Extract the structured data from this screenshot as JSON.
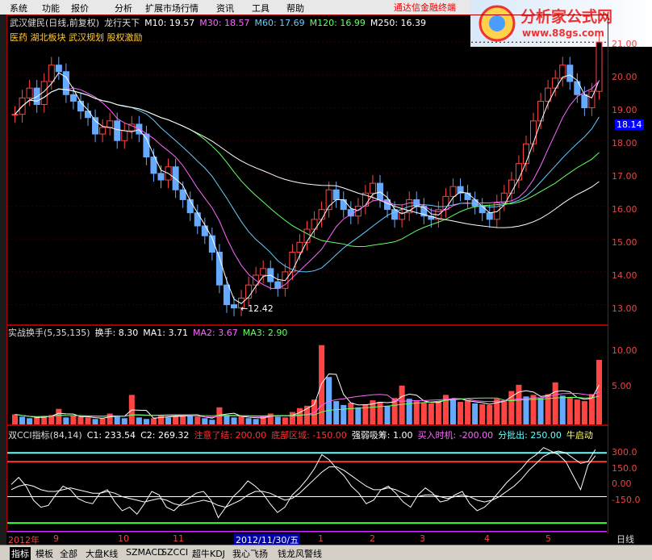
{
  "menu": [
    "系统",
    "功能",
    "报价",
    "分析",
    "扩展市场行情",
    "资讯",
    "工具",
    "帮助"
  ],
  "alert_text": "通达信金融终端",
  "brand": {
    "title": "分析家公式网",
    "url": "www.88gs.com"
  },
  "main_header": {
    "stock": "武汉健民(日线,前复权)",
    "indicator": "龙行天下",
    "items": [
      {
        "label": "M10: 19.57",
        "color": "#ffffff"
      },
      {
        "label": "M30: 18.57",
        "color": "#ff66ff"
      },
      {
        "label": "M60: 17.69",
        "color": "#66ccff"
      },
      {
        "label": "M120: 16.99",
        "color": "#66ff66"
      },
      {
        "label": "M250: 16.39",
        "color": "#ffffff"
      }
    ],
    "concepts": "医药 湖北板块 武汉规划 股权激励"
  },
  "vol_header": {
    "name": "实战换手(5,35,135)",
    "items": [
      {
        "label": "换手: 8.30",
        "color": "#ffffff"
      },
      {
        "label": "MA1: 3.71",
        "color": "#ffffff"
      },
      {
        "label": "MA2: 3.67",
        "color": "#ff66ff"
      },
      {
        "label": "MA3: 2.90",
        "color": "#66ff66"
      }
    ]
  },
  "cci_header": {
    "name": "双CCI指标(84,14)",
    "items": [
      {
        "label": "C1: 233.54",
        "color": "#ffffff"
      },
      {
        "label": "C2: 269.32",
        "color": "#ffffff"
      },
      {
        "label": "注意了结: 200.00",
        "color": "#ff3333"
      },
      {
        "label": "底部区域: -150.00",
        "color": "#ff3333"
      },
      {
        "label": "强弱吸筹: 1.00",
        "color": "#ffffff"
      },
      {
        "label": "买入时机: -200.00",
        "color": "#ff66ff"
      },
      {
        "label": "分批出: 250.00",
        "color": "#66ffff"
      },
      {
        "label": "牛启动",
        "color": "#ffff66"
      }
    ]
  },
  "price_scale": [
    "21.00",
    "20.00",
    "19.00",
    "18.00",
    "17.00",
    "16.00",
    "15.00",
    "14.00",
    "13.00"
  ],
  "current_price": "18.14",
  "low_marker": "12.42",
  "vol_scale": [
    "10.00",
    "5.00"
  ],
  "cci_scale": [
    "300.0",
    "150.0",
    "0.00",
    "-150.0"
  ],
  "date_labels": [
    "2012年",
    "9",
    "10",
    "11",
    "2012/11/30/五",
    "1",
    "2",
    "3",
    "4",
    "5"
  ],
  "period": "日线",
  "bottom_tabs": [
    "指标",
    "模板",
    "全部",
    "大盘K线",
    "SZMACD",
    "SZCCI",
    "超牛KDJ",
    "我心飞扬",
    "钱龙风警线"
  ],
  "chart_data": [
    {
      "type": "candlestick",
      "title": "武汉健民(日线,前复权)",
      "ylim": [
        12.4,
        21.3
      ],
      "series_close": [
        18.8,
        19.3,
        19.6,
        19.1,
        19.8,
        20.3,
        20.1,
        19.4,
        19.2,
        18.9,
        18.7,
        18.2,
        18.4,
        18.6,
        18.0,
        18.3,
        18.5,
        18.2,
        17.5,
        17.0,
        16.8,
        17.2,
        16.5,
        16.2,
        15.8,
        15.4,
        15.1,
        14.6,
        13.6,
        13.0,
        12.9,
        13.2,
        13.6,
        13.9,
        14.1,
        13.7,
        13.5,
        14.0,
        14.6,
        14.9,
        15.3,
        15.6,
        15.9,
        16.5,
        16.2,
        15.9,
        15.7,
        16.0,
        16.4,
        16.7,
        16.2,
        15.9,
        15.6,
        15.8,
        16.2,
        16.0,
        15.7,
        15.6,
        15.9,
        16.3,
        16.6,
        16.4,
        16.2,
        16.0,
        15.8,
        15.6,
        16.1,
        16.4,
        16.8,
        17.3,
        17.9,
        18.6,
        19.2,
        19.6,
        19.9,
        20.3,
        19.8,
        19.4,
        19.0,
        19.5,
        21.0
      ],
      "ma_lines": [
        "M10",
        "M30",
        "M60",
        "M120",
        "M250"
      ]
    },
    {
      "type": "bar",
      "title": "实战换手(5,35,135)",
      "ylim": [
        0,
        11
      ],
      "values": [
        1.3,
        1.0,
        0.8,
        0.9,
        1.1,
        1.2,
        2.0,
        0.9,
        1.1,
        1.0,
        0.9,
        0.7,
        0.8,
        1.4,
        1.0,
        0.8,
        3.8,
        0.9,
        0.7,
        0.8,
        1.2,
        0.9,
        1.0,
        1.3,
        1.1,
        1.0,
        0.8,
        0.6,
        2.2,
        1.2,
        0.9,
        1.1,
        0.8,
        0.7,
        1.0,
        1.4,
        1.0,
        0.9,
        1.6,
        2.1,
        2.4,
        3.2,
        10.2,
        6.1,
        3.0,
        2.5,
        2.8,
        2.2,
        2.6,
        3.1,
        2.9,
        2.4,
        3.4,
        5.0,
        3.3,
        3.0,
        2.8,
        2.7,
        3.0,
        3.8,
        3.2,
        2.9,
        3.1,
        2.7,
        2.6,
        2.5,
        3.3,
        3.1,
        4.3,
        5.1,
        3.6,
        3.8,
        3.4,
        3.9,
        5.4,
        3.7,
        3.5,
        3.2,
        3.0,
        3.9,
        8.3
      ]
    },
    {
      "type": "line",
      "title": "双CCI指标(84,14)",
      "ylim": [
        -200,
        320
      ],
      "series": [
        {
          "name": "C1",
          "values": [
            70,
            110,
            60,
            -20,
            -60,
            -50,
            10,
            60,
            40,
            -10,
            -30,
            -40,
            20,
            40,
            -30,
            -80,
            -60,
            -100,
            -40,
            30,
            10,
            -60,
            -80,
            -40,
            -10,
            20,
            30,
            -20,
            -120,
            -60,
            0,
            40,
            90,
            60,
            20,
            -40,
            -90,
            -60,
            10,
            50,
            100,
            160,
            240,
            210,
            160,
            120,
            60,
            20,
            -40,
            -20,
            40,
            60,
            20,
            -30,
            -60,
            10,
            50,
            20,
            -30,
            -20,
            10,
            30,
            -40,
            -80,
            -60,
            -20,
            30,
            80,
            120,
            160,
            210,
            240,
            280,
            260,
            240,
            200,
            120,
            40,
            180,
            233.5
          ]
        },
        {
          "name": "C2",
          "values": [
            40,
            60,
            70,
            60,
            40,
            30,
            30,
            40,
            50,
            40,
            30,
            20,
            20,
            30,
            20,
            0,
            -10,
            -20,
            -30,
            -20,
            -10,
            -20,
            -40,
            -50,
            -40,
            -30,
            -20,
            -30,
            -50,
            -60,
            -40,
            -20,
            10,
            30,
            30,
            20,
            0,
            -20,
            -10,
            20,
            60,
            100,
            140,
            170,
            170,
            150,
            120,
            90,
            60,
            40,
            40,
            50,
            40,
            20,
            0,
            0,
            10,
            10,
            0,
            -10,
            0,
            10,
            0,
            -20,
            -30,
            -20,
            0,
            30,
            60,
            100,
            150,
            190,
            230,
            250,
            260,
            250,
            220,
            190,
            200,
            269.3
          ]
        }
      ],
      "reference_lines": [
        {
          "name": "注意了结",
          "value": 200
        },
        {
          "name": "底部区域",
          "value": -150
        },
        {
          "name": "买入时机",
          "value": -200
        },
        {
          "name": "分批出",
          "value": 250
        }
      ]
    }
  ]
}
